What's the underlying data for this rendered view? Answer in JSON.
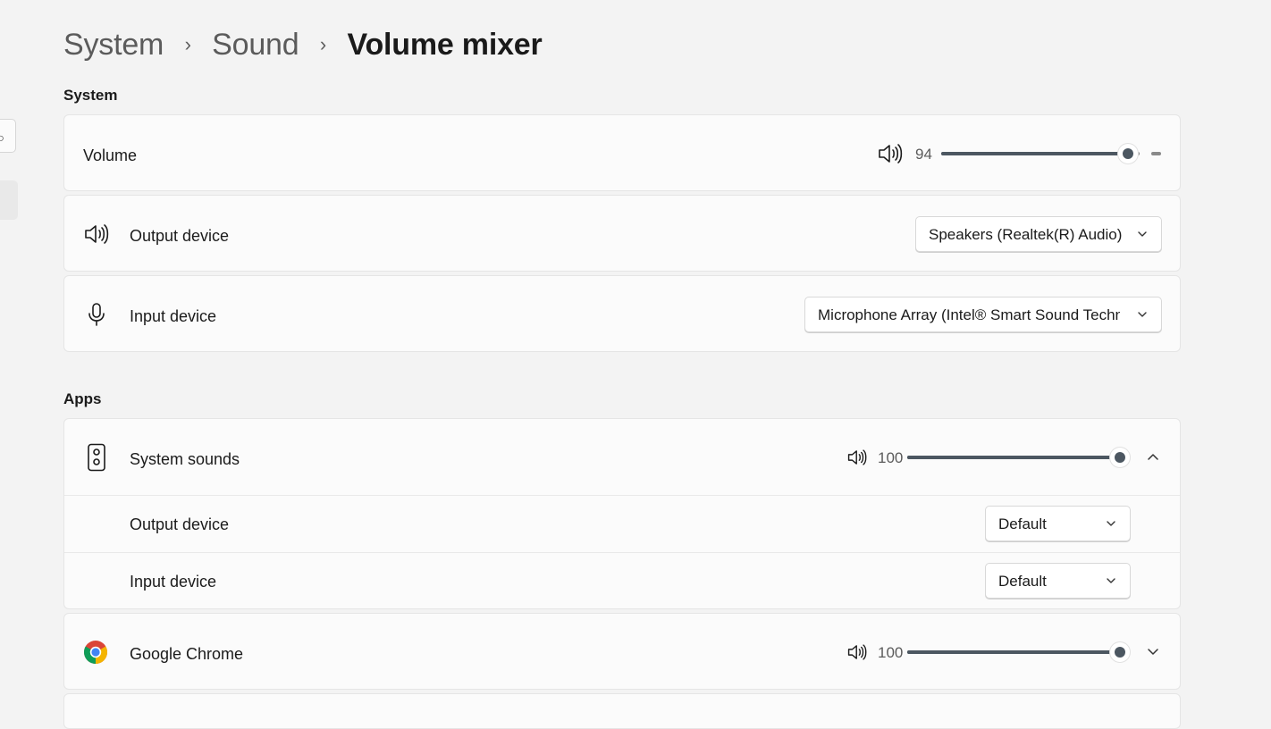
{
  "breadcrumb": {
    "items": [
      "System",
      "Sound"
    ],
    "current": "Volume mixer"
  },
  "system_section": {
    "title": "System",
    "volume": {
      "label": "Volume",
      "icon": "speaker-icon",
      "value": "94",
      "level": 94
    },
    "output_device": {
      "label": "Output device",
      "icon": "speaker-icon",
      "selected": "Speakers (Realtek(R) Audio)"
    },
    "input_device": {
      "label": "Input device",
      "icon": "microphone-icon",
      "selected": "Microphone Array (Intel® Smart Sound Technology for Digital Microphones)"
    }
  },
  "apps_section": {
    "title": "Apps",
    "system_sounds": {
      "label": "System sounds",
      "icon": "speaker-device-icon",
      "value": "100",
      "level": 100,
      "expanded": true,
      "output_device": {
        "label": "Output device",
        "selected": "Default"
      },
      "input_device": {
        "label": "Input device",
        "selected": "Default"
      }
    },
    "chrome": {
      "label": "Google Chrome",
      "icon": "chrome-icon",
      "value": "100",
      "level": 100,
      "expanded": false
    }
  },
  "colors": {
    "slider_fill": "#4c5761",
    "track": "#8a8a8a",
    "page_bg": "#f3f3f3",
    "card_bg": "#fbfbfb"
  }
}
